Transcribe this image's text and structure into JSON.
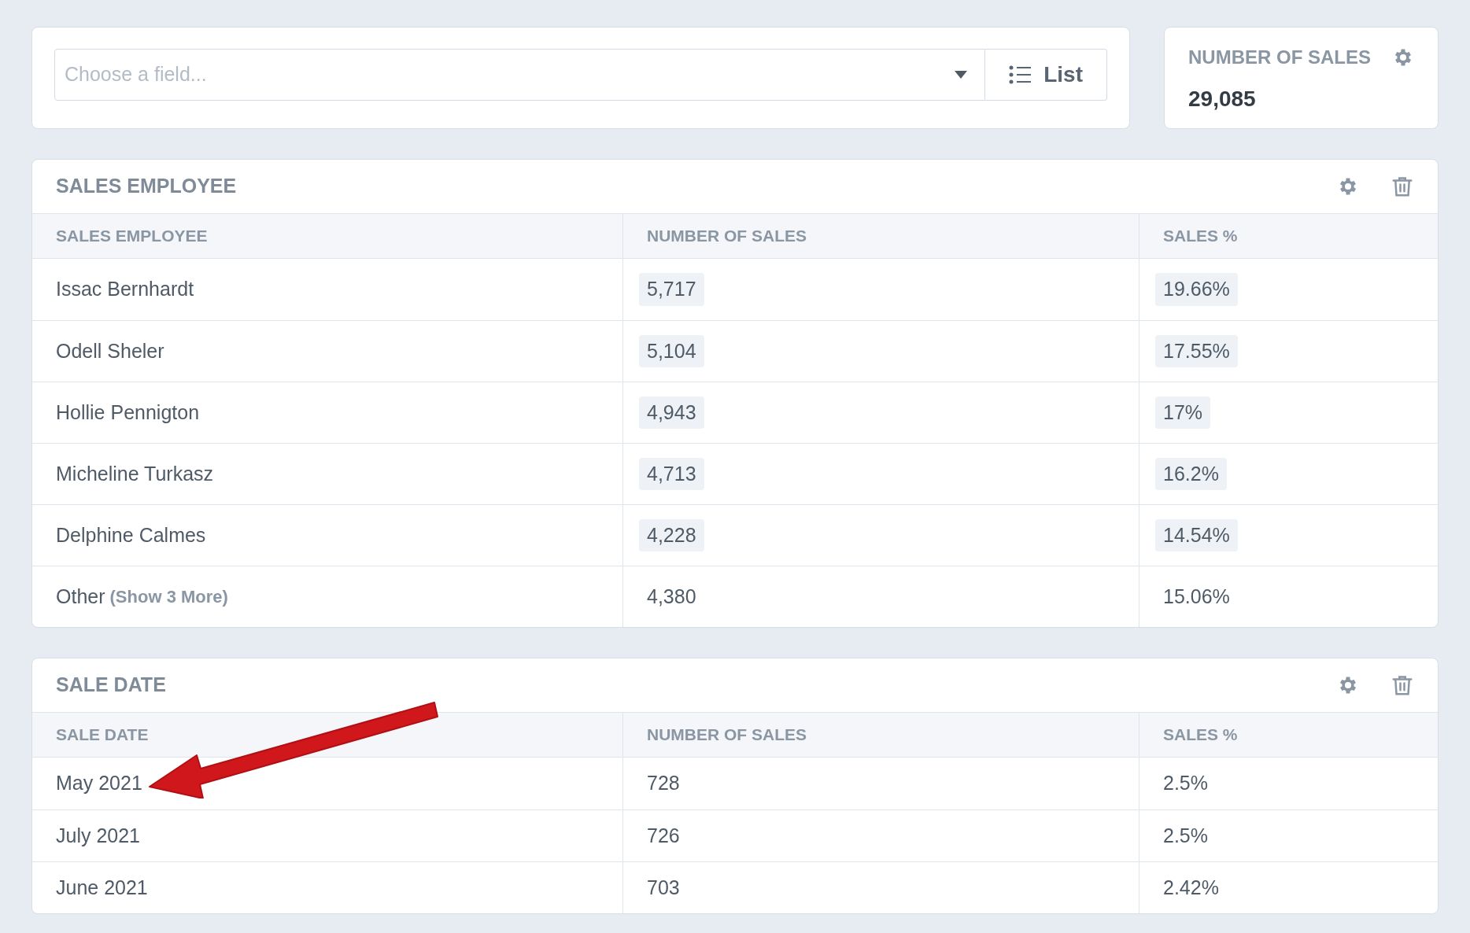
{
  "field_picker": {
    "placeholder": "Choose a field...",
    "view_button": "List"
  },
  "metric": {
    "label": "NUMBER OF SALES",
    "value": "29,085"
  },
  "panels": [
    {
      "title": "SALES EMPLOYEE",
      "columns": [
        "SALES EMPLOYEE",
        "NUMBER OF SALES",
        "SALES %"
      ],
      "rows": [
        {
          "name": "Issac Bernhardt",
          "count": "5,717",
          "percent": "19.66%",
          "highlighted": true
        },
        {
          "name": "Odell Sheler",
          "count": "5,104",
          "percent": "17.55%",
          "highlighted": true
        },
        {
          "name": "Hollie Pennigton",
          "count": "4,943",
          "percent": "17%",
          "highlighted": true
        },
        {
          "name": "Micheline Turkasz",
          "count": "4,713",
          "percent": "16.2%",
          "highlighted": true
        },
        {
          "name": "Delphine Calmes",
          "count": "4,228",
          "percent": "14.54%",
          "highlighted": true
        },
        {
          "name": "Other",
          "link": "(Show 3 More)",
          "count": "4,380",
          "percent": "15.06%",
          "highlighted": false
        }
      ]
    },
    {
      "title": "SALE DATE",
      "columns": [
        "SALE DATE",
        "NUMBER OF SALES",
        "SALES %"
      ],
      "rows": [
        {
          "name": "May 2021",
          "count": "728",
          "percent": "2.5%",
          "highlighted": false
        },
        {
          "name": "July 2021",
          "count": "726",
          "percent": "2.5%",
          "highlighted": false
        },
        {
          "name": "June 2021",
          "count": "703",
          "percent": "2.42%",
          "highlighted": false
        }
      ]
    }
  ]
}
